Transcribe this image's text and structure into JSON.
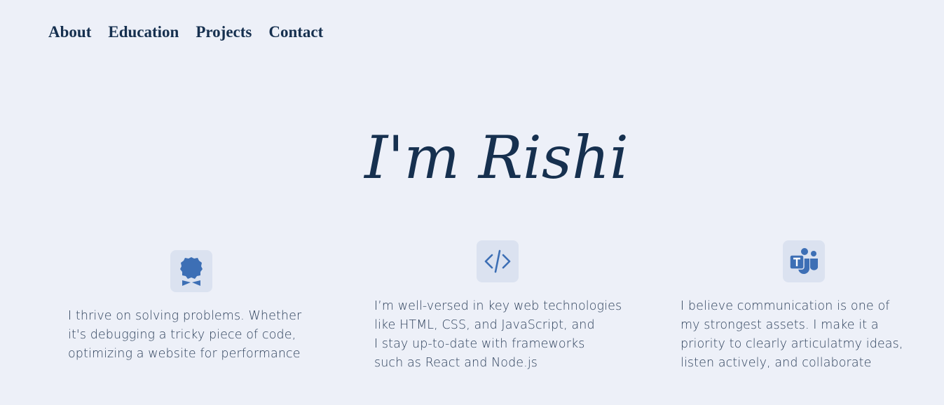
{
  "nav": {
    "items": [
      {
        "label": "About"
      },
      {
        "label": "Education"
      },
      {
        "label": "Projects"
      },
      {
        "label": "Contact"
      }
    ]
  },
  "hero": {
    "title": "I'm Rishi"
  },
  "features": [
    {
      "icon": "award-badge-icon",
      "lines": [
        "I thrive on solving problems. Whether",
        "it's debugging a tricky piece of code,",
        "optimizing a website for performance"
      ]
    },
    {
      "icon": "code-icon",
      "lines": [
        "I’m well-versed in key web technologies",
        "like HTML, CSS, and JavaScript, and",
        "I stay up-to-date with frameworks",
        "such as React and Node.js"
      ]
    },
    {
      "icon": "teams-icon",
      "lines": [
        "I believe communication is one of",
        "my strongest assets. I make it a",
        "priority to clearly articulatmy ideas,",
        "listen actively, and collaborate"
      ]
    }
  ],
  "colors": {
    "background": "#edf0f8",
    "text_dark": "#16304f",
    "icon_accent": "#3d6fb5",
    "icon_bg": "#dbe2f0"
  }
}
